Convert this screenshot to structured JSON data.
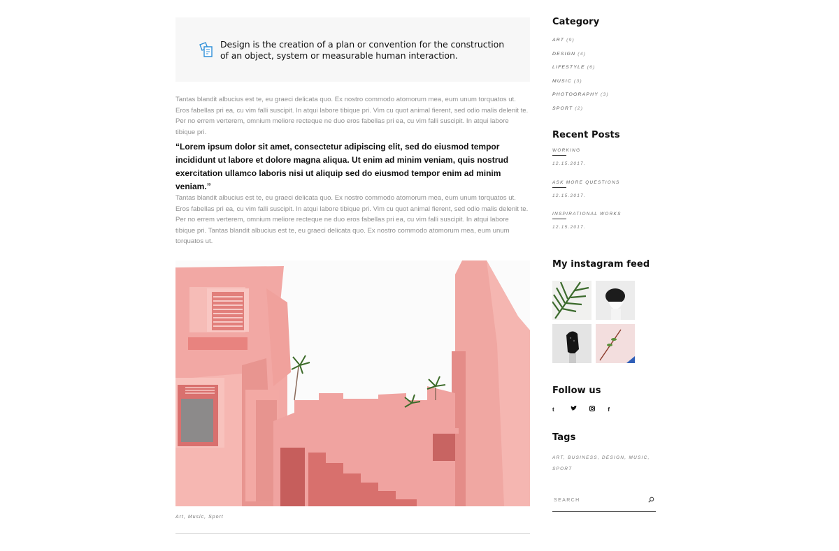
{
  "post": {
    "callout_text": "Design is the creation of a plan or convention for the construction of an object, system or measurable human interaction.",
    "callout_icon": "copy-icon",
    "paragraph_1": "Tantas blandit albucius est te, eu graeci delicata quo. Ex nostro commodo atomorum mea, eum unum torquatos ut. Eros fabellas pri ea, cu vim falli suscipit. In atqui labore tibique pri. Vim cu quot animal fierent, sed odio malis delenit te. Per no errem verterem, omnium meliore recteque ne duo eros fabellas pri ea, cu vim falli suscipit. In atqui labore tibique pri.",
    "blockquote": "“Lorem ipsum dolor sit amet, consectetur adipiscing elit, sed do eiusmod tempor incididunt ut labore et dolore magna aliqua. Ut enim ad minim veniam, quis nostrud exercitation ullamco laboris nisi ut aliquip sed do eiusmod tempor enim ad minim veniam.”",
    "paragraph_2": "Tantas blandit albucius est te, eu graeci delicata quo. Ex nostro commodo atomorum mea, eum unum torquatos ut. Eros fabellas pri ea, cu vim falli suscipit. In atqui labore tibique pri. Vim cu quot animal fierent, sed odio malis delenit te. Per no errem verterem, omnium meliore recteque ne duo eros fabellas pri ea, cu vim falli suscipit. In atqui labore tibique pri. Tantas blandit albucius est te, eu graeci delicata quo. Ex nostro commodo atomorum mea, eum unum torquatos ut.",
    "tags_line": "Art, Music, Sport"
  },
  "sidebar": {
    "category": {
      "title": "Category",
      "items": [
        {
          "label": "Art",
          "count": "(9)"
        },
        {
          "label": "Design",
          "count": "(4)"
        },
        {
          "label": "Lifestyle",
          "count": "(6)"
        },
        {
          "label": "Music",
          "count": "(3)"
        },
        {
          "label": "Photography",
          "count": "(3)"
        },
        {
          "label": "Sport",
          "count": "(2)"
        }
      ]
    },
    "recent": {
      "title": "Recent Posts",
      "items": [
        {
          "title": "WORKING",
          "date": "12.15.2017."
        },
        {
          "title": "ASK MORE QUESTIONS",
          "date": "12.15.2017."
        },
        {
          "title": "INSPIRATIONAL WORKS",
          "date": "12.15.2017."
        }
      ]
    },
    "instagram": {
      "title": "My instagram feed"
    },
    "follow": {
      "title": "Follow us",
      "icons": [
        "tumblr-icon",
        "twitter-icon",
        "instagram-icon",
        "facebook-icon"
      ],
      "glyphs": [
        "t",
        "🐦",
        "◙",
        "f"
      ]
    },
    "tags": {
      "title": "Tags",
      "text": "Art, Business, Design, Music, Sport"
    },
    "search": {
      "placeholder": "SEARCH",
      "icon": "search-icon"
    }
  }
}
